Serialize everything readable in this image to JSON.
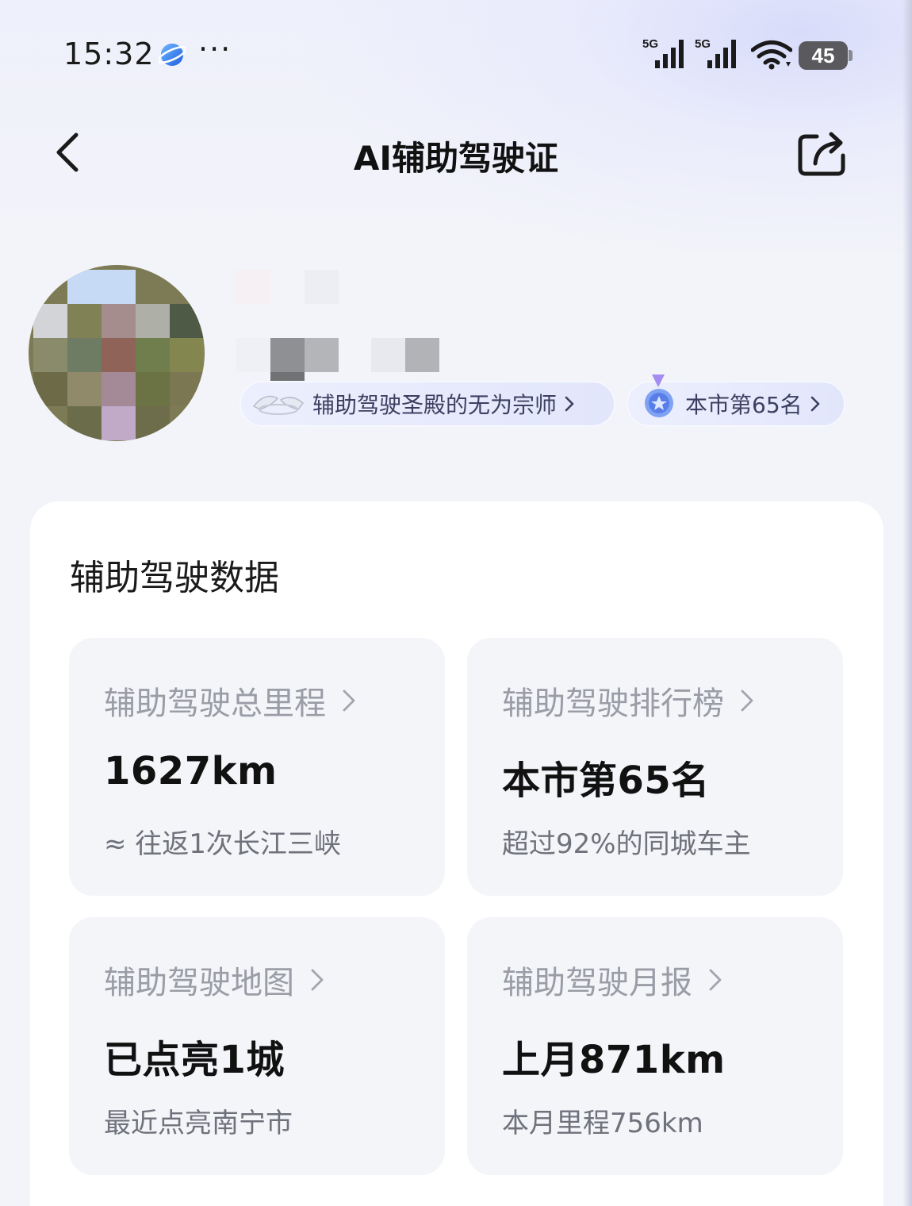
{
  "status_bar": {
    "time": "15:32",
    "network_1": "5G",
    "network_2": "5G",
    "battery": "45",
    "icons": [
      "app-notification-icon",
      "more-dots-icon",
      "signal-icon",
      "signal-icon",
      "wifi-icon",
      "battery-icon"
    ]
  },
  "nav": {
    "title": "AI辅助驾驶证",
    "back_icon": "chevron-left-icon",
    "share_icon": "share-icon"
  },
  "profile": {
    "badge_title": "辅助驾驶圣殿的无为宗师",
    "badge_rank": "本市第65名"
  },
  "data_section": {
    "title": "辅助驾驶数据",
    "tiles": [
      {
        "label": "辅助驾驶总里程",
        "value": "1627km",
        "sub": "≈ 往返1次长江三峡"
      },
      {
        "label": "辅助驾驶排行榜",
        "value": "本市第65名",
        "sub": "超过92%的同城车主"
      },
      {
        "label": "辅助驾驶地图",
        "value": "已点亮1城",
        "sub": "最近点亮南宁市"
      },
      {
        "label": "辅助驾驶月报",
        "value": "上月871km",
        "sub": "本月里程756km"
      }
    ]
  }
}
